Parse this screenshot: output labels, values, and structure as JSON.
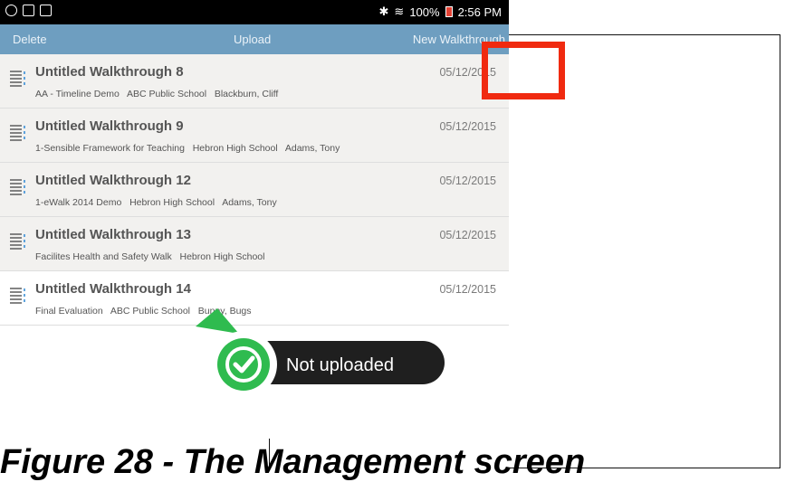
{
  "statusbar": {
    "battery": "100%",
    "time": "2:56 PM"
  },
  "toolbar": {
    "delete_label": "Delete",
    "upload_label": "Upload",
    "new_label": "New Walkthrough"
  },
  "items": [
    {
      "title": "Untitled Walkthrough 8",
      "details": "AA - Timeline Demo   ABC Public School   Blackburn, Cliff",
      "date": "05/12/2015"
    },
    {
      "title": "Untitled Walkthrough 9",
      "details": "1-Sensible Framework for Teaching   Hebron High School   Adams, Tony",
      "date": "05/12/2015"
    },
    {
      "title": "Untitled Walkthrough 12",
      "details": "1-eWalk 2014 Demo   Hebron High School   Adams, Tony",
      "date": "05/12/2015"
    },
    {
      "title": "Untitled Walkthrough 13",
      "details": "Facilites Health and Safety Walk   Hebron High School",
      "date": "05/12/2015"
    },
    {
      "title": "Untitled Walkthrough 14",
      "details": "Final Evaluation   ABC Public School   Bunny, Bugs",
      "date": "05/12/2015"
    }
  ],
  "callout": {
    "label": "Not uploaded",
    "check_color": "#2fbb4f"
  },
  "caption": "Figure 28 - The Management screen",
  "colors": {
    "toolbar": "#6e9ec0",
    "highlight": "#f02a10",
    "icon_blue": "#3a8fd6"
  },
  "icons": [
    "settings-icon",
    "screen-icon",
    "image-icon",
    "bluetooth-icon",
    "wifi-icon",
    "battery-icon",
    "document-icon",
    "checkmark-icon"
  ]
}
